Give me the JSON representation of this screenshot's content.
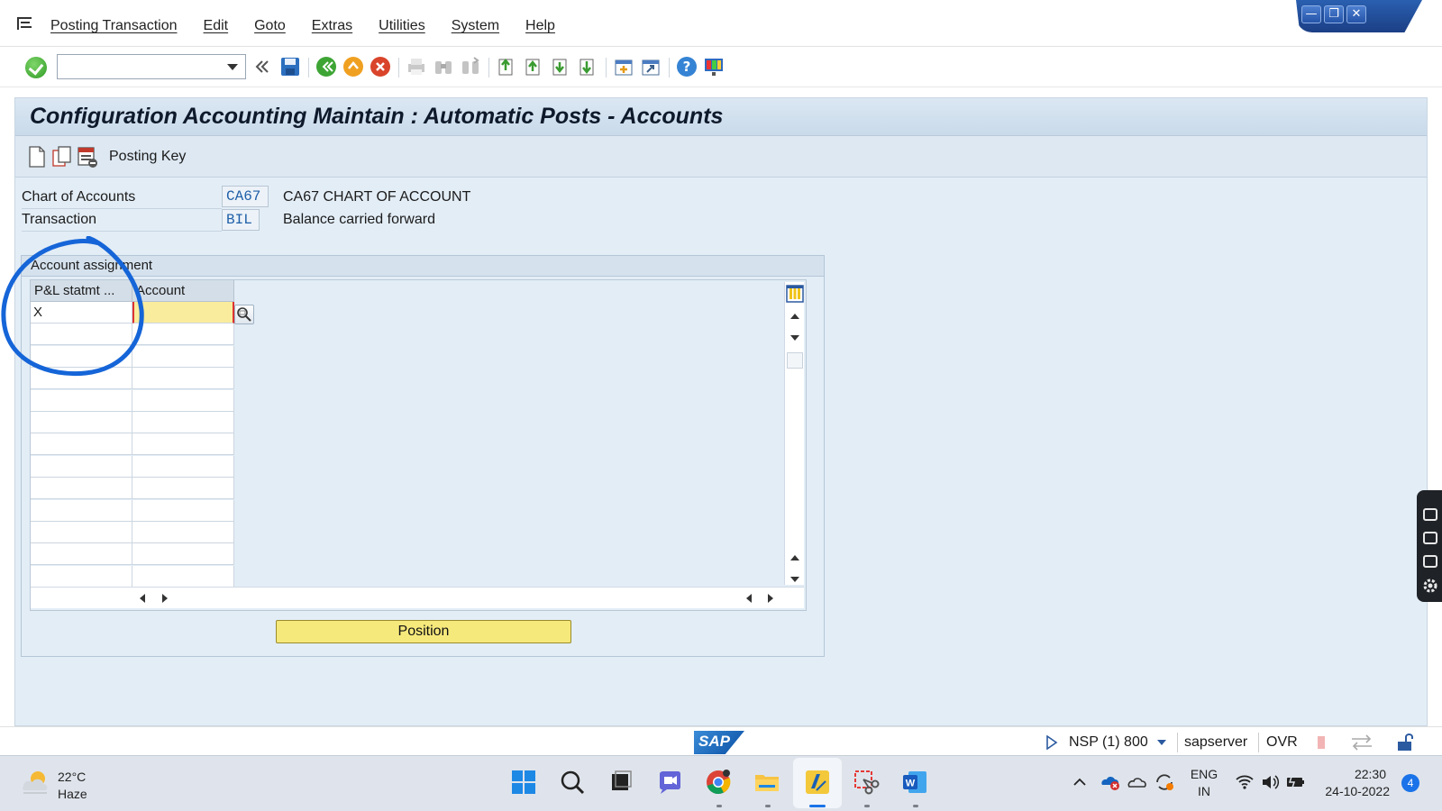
{
  "menubar": {
    "items": [
      "Posting Transaction",
      "Edit",
      "Goto",
      "Extras",
      "Utilities",
      "System",
      "Help"
    ]
  },
  "toolbar": {
    "command_value": ""
  },
  "screen": {
    "title": "Configuration Accounting Maintain : Automatic Posts - Accounts",
    "app_toolbar": {
      "posting_key_label": "Posting Key"
    },
    "fields": {
      "chart_label": "Chart of Accounts",
      "chart_value": "CA67",
      "chart_desc": "CA67 CHART OF ACCOUNT",
      "transaction_label": "Transaction",
      "transaction_value": "BIL",
      "transaction_desc": "Balance carried forward"
    },
    "group": {
      "title": "Account assignment",
      "columns": [
        "P&L statmt ...",
        "Account"
      ],
      "rows": [
        [
          "X",
          ""
        ],
        [
          "",
          ""
        ],
        [
          "",
          ""
        ],
        [
          "",
          ""
        ],
        [
          "",
          ""
        ],
        [
          "",
          ""
        ],
        [
          "",
          ""
        ],
        [
          "",
          ""
        ],
        [
          "",
          ""
        ],
        [
          "",
          ""
        ],
        [
          "",
          ""
        ],
        [
          "",
          ""
        ],
        [
          "",
          ""
        ]
      ]
    },
    "position_button": "Position"
  },
  "statusbar": {
    "system": "NSP (1) 800",
    "server": "sapserver",
    "mode": "OVR"
  },
  "taskbar": {
    "weather_temp": "22°C",
    "weather_desc": "Haze",
    "lang_1": "ENG",
    "lang_2": "IN",
    "time": "22:30",
    "date": "24-10-2022",
    "notifications": "4"
  },
  "colors": {
    "annotation": "#1565d8",
    "required_field": "#f9ec9c",
    "sap_blue": "#0a4ea3"
  }
}
